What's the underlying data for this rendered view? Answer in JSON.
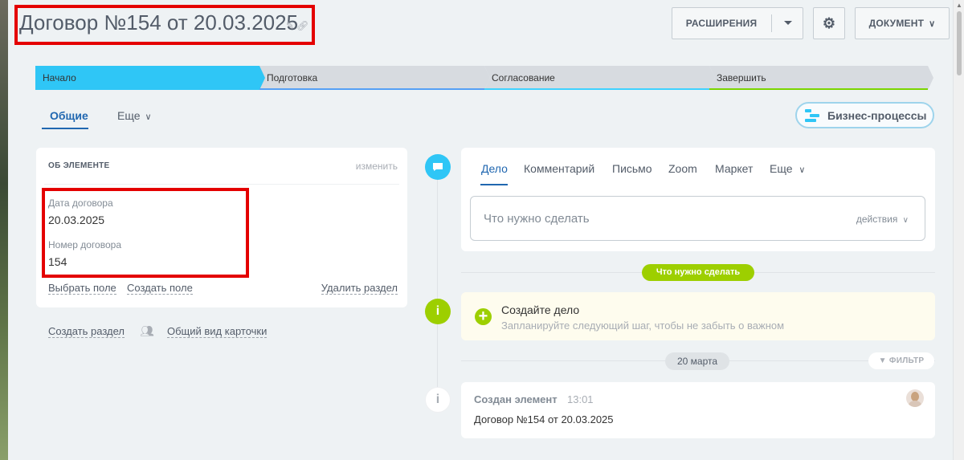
{
  "header": {
    "title": "Договор №154 от 20.03.2025",
    "title_icons": [
      "pencil-icon",
      "link-icon"
    ],
    "extensions_label": "РАСШИРЕНИЯ",
    "document_label": "ДОКУМЕНТ"
  },
  "stages": [
    {
      "label": "Начало",
      "color": "#2fc6f6",
      "active": true
    },
    {
      "label": "Подготовка",
      "color": "#55a0f5",
      "active": false
    },
    {
      "label": "Согласование",
      "color": "#3fd2ff",
      "active": false
    },
    {
      "label": "Завершить",
      "color": "#7bd500",
      "active": false
    }
  ],
  "tabs": {
    "general": "Общие",
    "more": "Еще"
  },
  "business_processes": "Бизнес-процессы",
  "about": {
    "title": "ОБ ЭЛЕМЕНТЕ",
    "edit": "изменить",
    "fields": [
      {
        "label": "Дата договора",
        "value": "20.03.2025"
      },
      {
        "label": "Номер договора",
        "value": "154"
      }
    ],
    "select_field": "Выбрать поле",
    "create_field": "Создать поле",
    "delete_section": "Удалить раздел"
  },
  "below_card": {
    "create_section": "Создать раздел",
    "card_view": "Общий вид карточки"
  },
  "activity": {
    "tabs": [
      "Дело",
      "Комментарий",
      "Письмо",
      "Zoom",
      "Маркет",
      "Еще"
    ],
    "placeholder": "Что нужно сделать",
    "actions": "действия"
  },
  "timeline": {
    "todo_pill": "Что нужно сделать",
    "todo_title": "Создайте дело",
    "todo_hint": "Запланируйте следующий шаг, чтобы не забыть о важном",
    "date_pill": "20 марта",
    "filter": "ФИЛЬТР",
    "created_title": "Создан элемент",
    "created_time": "13:01",
    "created_body": "Договор №154 от 20.03.2025"
  },
  "colors": {
    "accent_blue": "#2067b0",
    "timeline_blue": "#2fc6f6",
    "green": "#9dcf00",
    "highlight_red": "#e40000"
  }
}
